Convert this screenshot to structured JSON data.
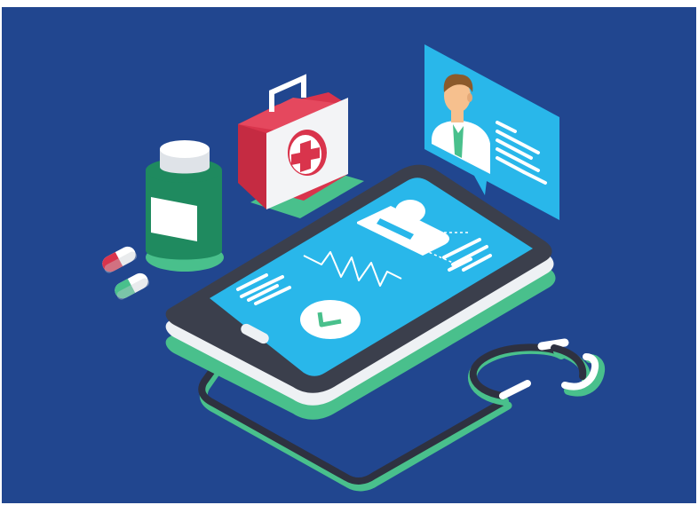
{
  "colors": {
    "background": "#21468f",
    "screen": "#29b7ea",
    "green": "#49c08c",
    "dark_green": "#1f8a5f",
    "red": "#d9344c",
    "white": "#ffffff",
    "device_dark": "#3b3f4c",
    "skin": "#f6c08e",
    "hair": "#8b5a2b"
  },
  "icons": [
    "medicine-bottle-icon",
    "pill-capsule-icon",
    "first-aid-kit-icon",
    "doctor-chat-bubble-icon",
    "tablet-icon",
    "patient-avatar-icon",
    "heartbeat-icon",
    "clock-icon",
    "stethoscope-icon"
  ]
}
